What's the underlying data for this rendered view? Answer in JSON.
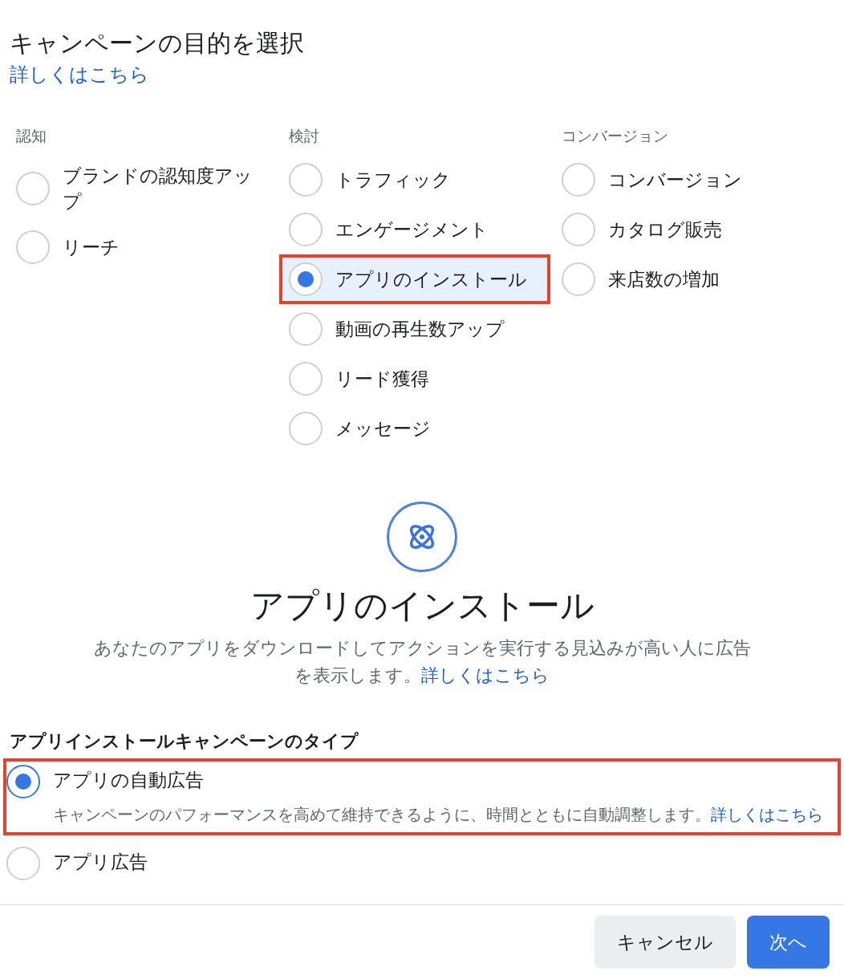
{
  "dialog": {
    "title": "キャンペーンの目的を選択",
    "learn_more": "詳しくはこちら"
  },
  "objective_groups": [
    {
      "heading": "認知",
      "items": [
        {
          "label": "ブランドの認知度アップ",
          "selected": false,
          "highlighted": false
        },
        {
          "label": "リーチ",
          "selected": false,
          "highlighted": false
        }
      ]
    },
    {
      "heading": "検討",
      "items": [
        {
          "label": "トラフィック",
          "selected": false,
          "highlighted": false
        },
        {
          "label": "エンゲージメント",
          "selected": false,
          "highlighted": false
        },
        {
          "label": "アプリのインストール",
          "selected": true,
          "highlighted": true
        },
        {
          "label": "動画の再生数アップ",
          "selected": false,
          "highlighted": false
        },
        {
          "label": "リード獲得",
          "selected": false,
          "highlighted": false
        },
        {
          "label": "メッセージ",
          "selected": false,
          "highlighted": false
        }
      ]
    },
    {
      "heading": "コンバージョン",
      "items": [
        {
          "label": "コンバージョン",
          "selected": false,
          "highlighted": false
        },
        {
          "label": "カタログ販売",
          "selected": false,
          "highlighted": false
        },
        {
          "label": "来店数の増加",
          "selected": false,
          "highlighted": false
        }
      ]
    }
  ],
  "objective_detail": {
    "title": "アプリのインストール",
    "description": "あなたのアプリをダウンロードしてアクションを実行する見込みが高い人に広告を表示します。",
    "learn_more": "詳しくはこちら"
  },
  "campaign_type": {
    "heading": "アプリインストールキャンペーンのタイプ",
    "options": [
      {
        "label": "アプリの自動広告",
        "description": "キャンペーンのパフォーマンスを高めて維持できるように、時間とともに自動調整します。",
        "learn_more": "詳しくはこちら",
        "selected": true,
        "highlighted": true
      },
      {
        "label": "アプリ広告",
        "selected": false,
        "highlighted": false
      }
    ]
  },
  "footer": {
    "buttons": [
      {
        "label": "キャンセル",
        "kind": "secondary"
      },
      {
        "label": "次へ",
        "kind": "primary"
      }
    ]
  }
}
